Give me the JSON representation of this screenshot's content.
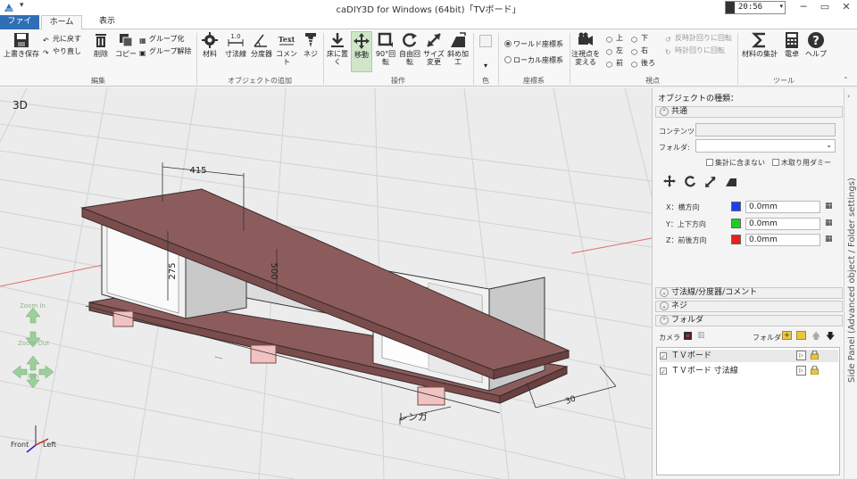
{
  "window": {
    "title": "caDIY3D for Windows (64bit)「TVボード」",
    "clock": "20:56",
    "quick_access": "▾"
  },
  "tabs": [
    "ファイル",
    "ホーム",
    "表示"
  ],
  "ribbon": {
    "edit": {
      "overwrite_save": "上書き保存",
      "undo": "元に戻す",
      "redo": "やり直し",
      "delete": "削除",
      "copy": "コピー",
      "group": "グループ化",
      "ungroup": "グループ解除",
      "group_label": "編集"
    },
    "add": {
      "material": "材料",
      "dimension": "寸法線",
      "protractor": "分度器",
      "comment": "コメント",
      "screw": "ネジ",
      "dim_icon_text": "1.0",
      "text_icon_text": "Text",
      "group_label": "オブジェクトの追加"
    },
    "operation": {
      "place_floor": "床に置く",
      "move": "移動",
      "rotate90": "90°回転",
      "free_rotate": "自由回転",
      "resize": "サイズ変更",
      "bevel": "斜め加工",
      "group_label": "操作"
    },
    "color": {
      "group_label": "色",
      "arrow": "▾"
    },
    "coords": {
      "world": "ワールド座標系",
      "local": "ローカル座標系",
      "group_label": "座標系"
    },
    "view": {
      "change_viewpoint": "注視点を変える",
      "top": "上",
      "bottom": "下",
      "left": "左",
      "right": "右",
      "front": "前",
      "back": "後ろ",
      "ccw": "反時計回りに回転",
      "cw": "時計回りに回転",
      "group_label": "視点"
    },
    "tools": {
      "material_total": "材料の集計",
      "calculator": "電卓",
      "help": "ヘルプ",
      "group_label": "ツール"
    }
  },
  "viewport": {
    "label": "3D",
    "nav": {
      "zoom_in": "Zoom In",
      "zoom_out": "Zoom Out",
      "pan": "Pan"
    },
    "axes": {
      "front": "Front",
      "left": "Left"
    },
    "dims": {
      "width": "415",
      "height": "275",
      "depth": "500",
      "side": "30",
      "bottom": "---"
    },
    "annotation": "レンガ"
  },
  "side_panel": {
    "header": "オブジェクトの種類：",
    "common": "共通",
    "content_label": "コンテンツ:",
    "content_value": "",
    "folder_label": "フォルダ:",
    "folder_value": "",
    "exclude_total": "集計に含まない",
    "dummy": "木取り用ダミー",
    "x_label": "X：横方向",
    "y_label": "Y：上下方向",
    "z_label": "Z：前後方向",
    "x_value": "0.0mm",
    "y_value": "0.0mm",
    "z_value": "0.0mm",
    "colors": {
      "x": "#1f3ff0",
      "y": "#22cc22",
      "z": "#e82020"
    },
    "dim_section": "寸法線/分度器/コメント",
    "screw_section": "ネジ",
    "folder_section": "フォルダ",
    "camera": "カメラ",
    "folder_tools": "フォルダ",
    "tree": [
      "ＴＶボード",
      "ＴＶボード 寸法線"
    ],
    "vertical_tab": "Side Panel (Advanced object / Folder settings)"
  }
}
